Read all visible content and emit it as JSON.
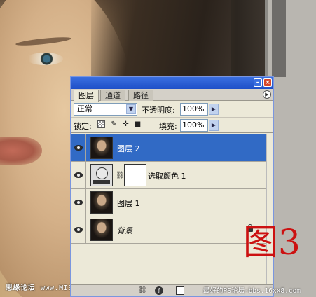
{
  "panel": {
    "tabs": [
      {
        "label": "图层",
        "active": true
      },
      {
        "label": "通道",
        "active": false
      },
      {
        "label": "路径",
        "active": false
      }
    ],
    "blend_mode": "正常",
    "opacity_label": "不透明度:",
    "opacity_value": "100%",
    "lock_label": "锁定:",
    "fill_label": "填充:",
    "fill_value": "100%"
  },
  "layers": [
    {
      "name": "图层 2",
      "selected": true,
      "visible": true,
      "thumb": "portrait"
    },
    {
      "name": "选取颜色 1",
      "selected": false,
      "visible": true,
      "thumb": "adjustment-selective-color",
      "has_mask": true
    },
    {
      "name": "图层 1",
      "selected": false,
      "visible": true,
      "thumb": "portrait"
    },
    {
      "name": "背景",
      "selected": false,
      "visible": true,
      "thumb": "portrait",
      "locked": true
    }
  ],
  "overlay": {
    "figure_label": "图3",
    "watermark_left_cn": "思缘论坛",
    "watermark_left_url": "www.MISSYUAN.COM",
    "watermark_right": "最好的PS论坛-bbs.16xx8.com"
  },
  "colors": {
    "selection": "#316ac5",
    "titlebar": "#1e4fc8",
    "figure_label": "#cc1111"
  }
}
